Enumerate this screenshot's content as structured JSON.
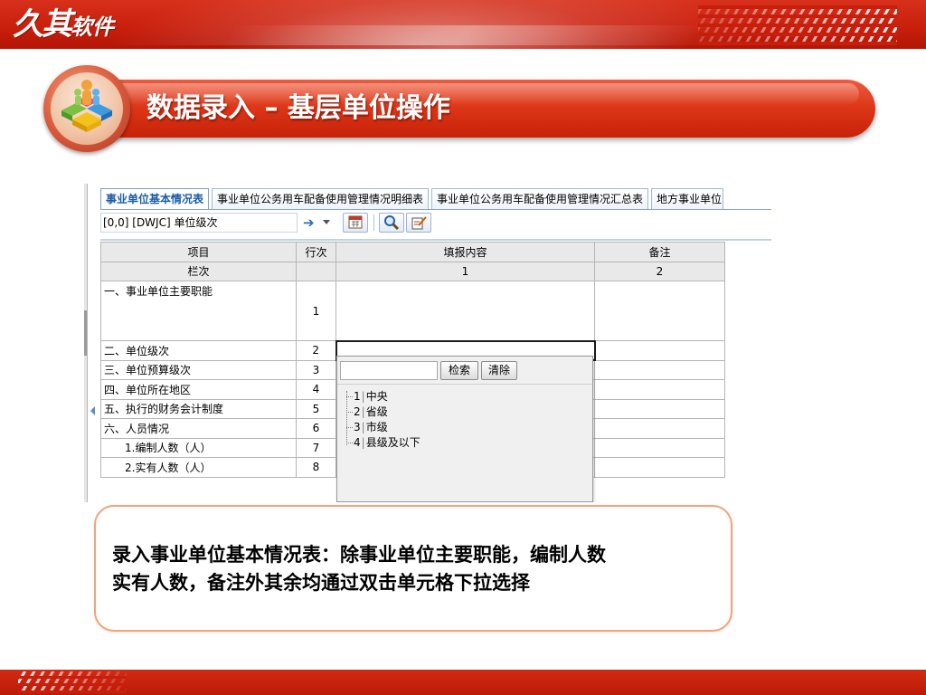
{
  "brand": {
    "logo_main": "久其",
    "logo_sub": "软件"
  },
  "slide": {
    "title": "数据录入 – 基层单位操作"
  },
  "app": {
    "tabs": [
      {
        "label": "事业单位基本情况表",
        "active": true
      },
      {
        "label": "事业单位公务用车配备使用管理情况明细表",
        "active": false
      },
      {
        "label": "事业单位公务用车配备使用管理情况汇总表",
        "active": false
      },
      {
        "label": "地方事业单位",
        "active": false
      }
    ],
    "toolbar": {
      "cell_address": "[0,0] [DWJC] 单位级次",
      "icons": [
        "arrow-right-icon",
        "calendar-icon",
        "magnifier-icon",
        "edit-icon"
      ]
    },
    "table": {
      "headers": [
        "项目",
        "行次",
        "填报内容",
        "备注"
      ],
      "subheaders": [
        "栏次",
        "",
        "1",
        "2"
      ],
      "rows": [
        {
          "item": "一、事业单位主要职能",
          "line": "1"
        },
        {
          "item": "二、单位级次",
          "line": "2"
        },
        {
          "item": "三、单位预算级次",
          "line": "3"
        },
        {
          "item": "四、单位所在地区",
          "line": "4"
        },
        {
          "item": "五、执行的财务会计制度",
          "line": "5"
        },
        {
          "item": "六、人员情况",
          "line": "6"
        },
        {
          "item": "1.编制人数（人）",
          "line": "7"
        },
        {
          "item": "2.实有人数（人）",
          "line": "8"
        }
      ]
    },
    "dropdown": {
      "search_value": "",
      "search_button": "检索",
      "clear_button": "清除",
      "options": [
        {
          "code": "1",
          "label": "中央"
        },
        {
          "code": "2",
          "label": "省级"
        },
        {
          "code": "3",
          "label": "市级"
        },
        {
          "code": "4",
          "label": "县级及以下"
        }
      ]
    }
  },
  "note": {
    "line1": "录入事业单位基本情况表：除事业单位主要职能，编制人数",
    "line2": "实有人数，备注外其余均通过双击单元格下拉选择"
  },
  "colors": {
    "brand_red": "#c81e0c",
    "tab_active_text": "#1a5ca8",
    "note_border": "#f2a37a"
  }
}
